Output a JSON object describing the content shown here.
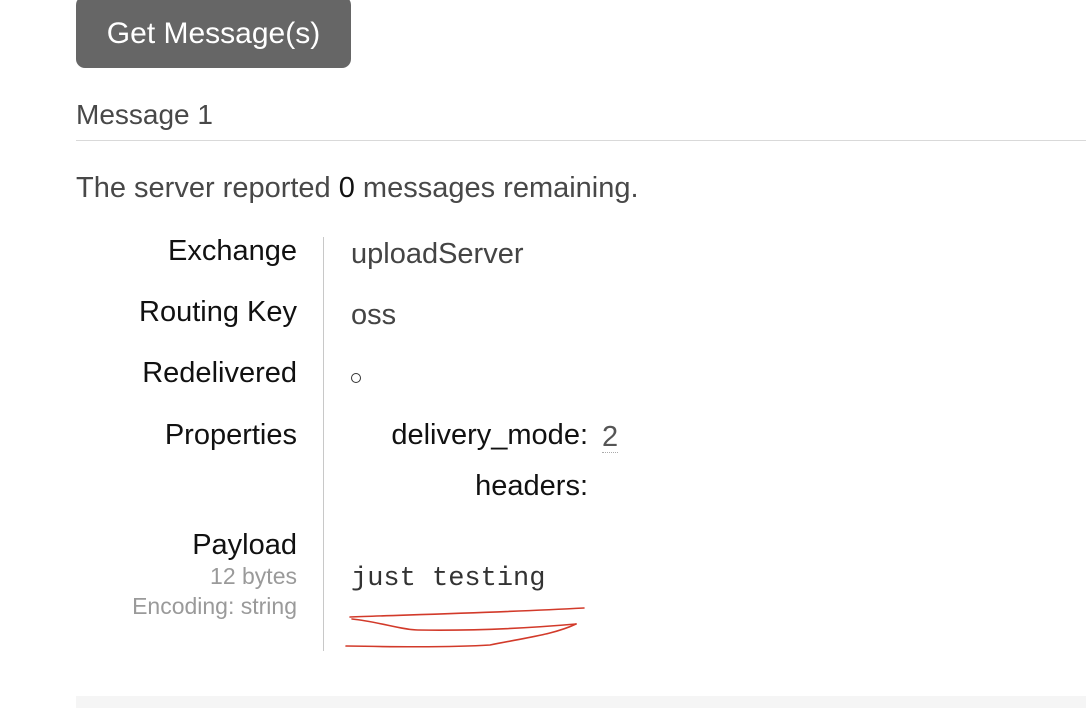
{
  "toolbar": {
    "get_messages_label": "Get Message(s)"
  },
  "message": {
    "heading": "Message 1",
    "summary_prefix": "The server reported ",
    "remaining_count": "0",
    "summary_suffix": " messages remaining."
  },
  "fields": {
    "exchange_label": "Exchange",
    "exchange_value": "uploadServer",
    "routing_key_label": "Routing Key",
    "routing_key_value": "oss",
    "redelivered_label": "Redelivered",
    "redelivered_value": "○",
    "properties_label": "Properties",
    "properties": {
      "delivery_mode_key": "delivery_mode:",
      "delivery_mode_value": "2",
      "headers_key": "headers:"
    },
    "payload_label": "Payload",
    "payload_size": "12 bytes",
    "payload_encoding": "Encoding: string",
    "payload_value": "just testing"
  },
  "colors": {
    "button_bg": "#666666",
    "annotation_red": "#d23a2a"
  }
}
